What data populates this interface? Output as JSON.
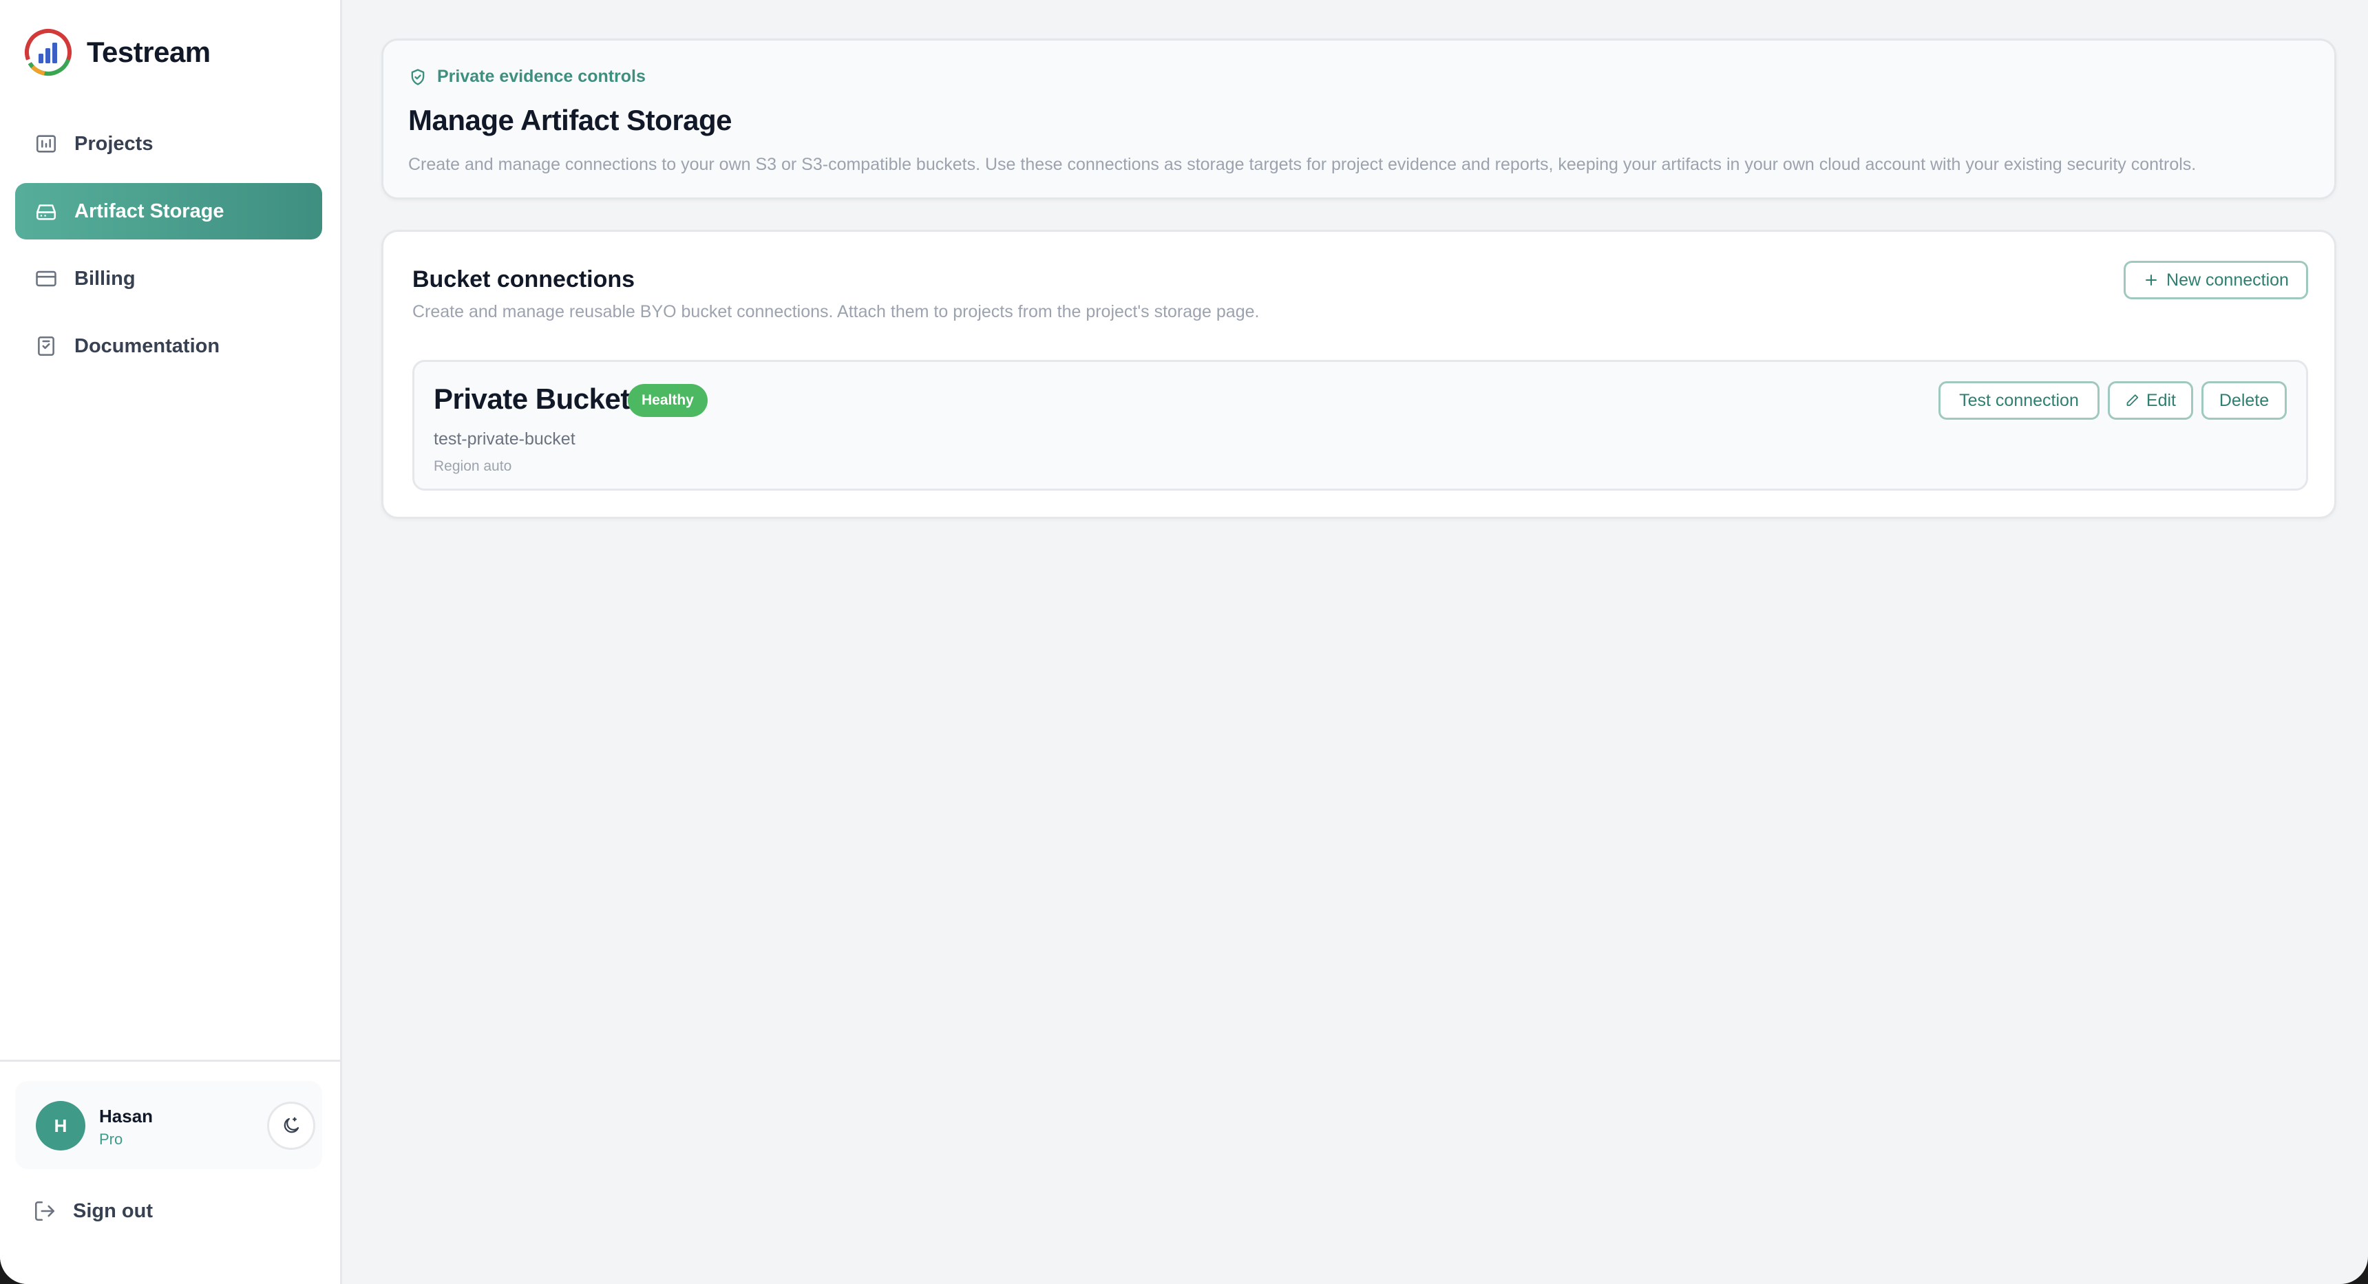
{
  "brand": {
    "name": "Testream"
  },
  "sidebar": {
    "items": [
      {
        "label": "Projects",
        "icon": "projects-icon"
      },
      {
        "label": "Artifact Storage",
        "icon": "storage-icon",
        "active": true
      },
      {
        "label": "Billing",
        "icon": "billing-icon"
      },
      {
        "label": "Documentation",
        "icon": "documentation-icon"
      }
    ],
    "user": {
      "initial": "H",
      "name": "Hasan",
      "plan": "Pro"
    },
    "sign_out_label": "Sign out"
  },
  "hero": {
    "tag": "Private evidence controls",
    "title": "Manage Artifact Storage",
    "description": "Create and manage connections to your own S3 or S3-compatible buckets. Use these connections as storage targets for project evidence and reports, keeping your artifacts in your own cloud account with your existing security controls."
  },
  "connections": {
    "title": "Bucket connections",
    "description": "Create and manage reusable BYO bucket connections. Attach them to projects from the project's storage page.",
    "new_label": "New connection",
    "buckets": [
      {
        "name": "Private Bucket",
        "status": "Healthy",
        "id": "test-private-bucket",
        "region": "Region auto",
        "test_label": "Test connection",
        "edit_label": "Edit",
        "delete_label": "Delete"
      }
    ]
  },
  "colors": {
    "accent": "#3f8f80",
    "healthy": "#4cb962",
    "background": "#f3f4f6"
  }
}
